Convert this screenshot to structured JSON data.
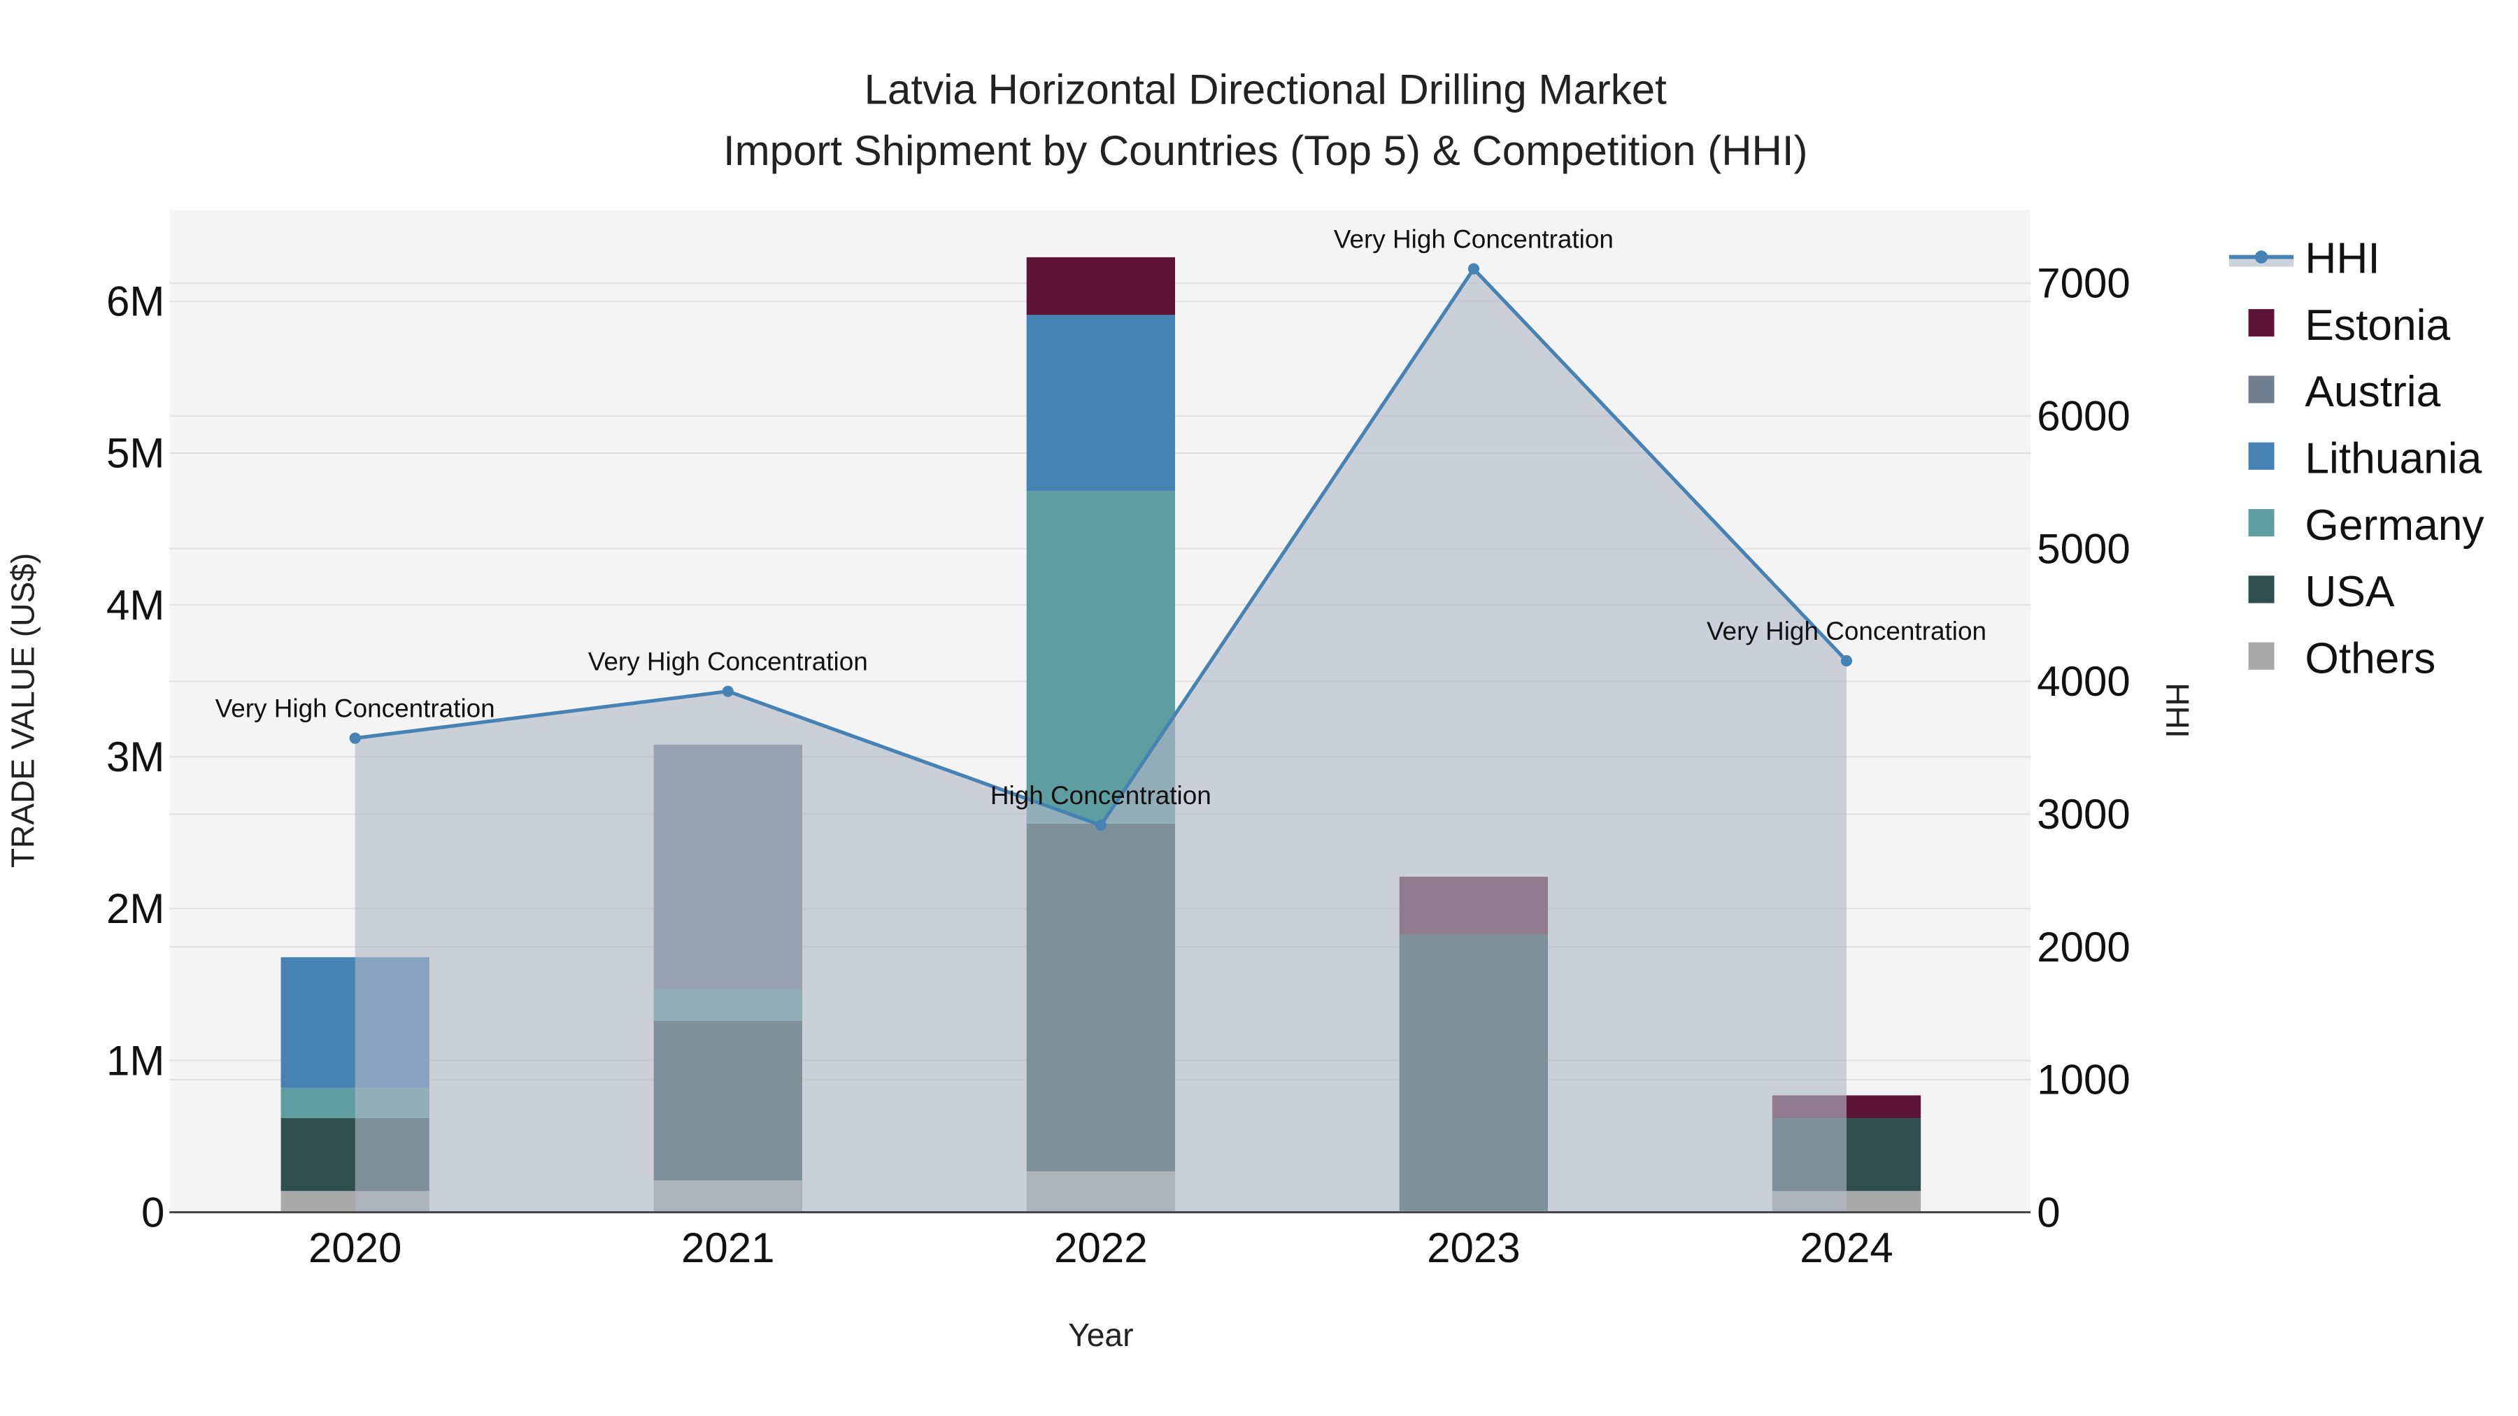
{
  "chart_data": {
    "type": "bar",
    "stacked": true,
    "title_line1": "Latvia Horizontal Directional Drilling Market",
    "title_line2": "Import Shipment by Countries (Top 5) & Competition (HHI)",
    "xlabel": "Year",
    "ylabel": "TRADE VALUE (US$)",
    "y2label": "HHI",
    "categories": [
      "2020",
      "2021",
      "2022",
      "2023",
      "2024"
    ],
    "ylim": [
      0,
      6.6
    ],
    "y_unit": "M",
    "y_ticks": [
      0,
      1,
      2,
      3,
      4,
      5,
      6
    ],
    "y_tick_labels": [
      "0",
      "1M",
      "2M",
      "3M",
      "4M",
      "5M",
      "6M"
    ],
    "y2lim": [
      0,
      7550
    ],
    "y2_ticks": [
      0,
      1000,
      2000,
      3000,
      4000,
      5000,
      6000,
      7000
    ],
    "y2_tick_labels": [
      "0",
      "1000",
      "2000",
      "3000",
      "4000",
      "5000",
      "6000",
      "7000"
    ],
    "series": [
      {
        "name": "Others",
        "color": "#a9a9a9",
        "values": [
          0.14,
          0.21,
          0.27,
          0.01,
          0.14
        ]
      },
      {
        "name": "USA",
        "color": "#2f4f4f",
        "values": [
          0.48,
          1.05,
          2.29,
          1.82,
          0.48
        ]
      },
      {
        "name": "Germany",
        "color": "#5f9ea0",
        "values": [
          0.2,
          0.21,
          2.19,
          0,
          0
        ]
      },
      {
        "name": "Lithuania",
        "color": "#4682b4",
        "values": [
          0.86,
          0,
          1.16,
          0,
          0
        ]
      },
      {
        "name": "Austria",
        "color": "#708090",
        "values": [
          0,
          1.61,
          0,
          0,
          0
        ]
      },
      {
        "name": "Estonia",
        "color": "#5e1535",
        "values": [
          0,
          0,
          0.38,
          0.38,
          0.15
        ]
      }
    ],
    "hhi": {
      "name": "HHI",
      "color": "#4682b4",
      "values": [
        3572,
        3925,
        2916,
        7108,
        4155
      ],
      "annotations": [
        "Very High Concentration",
        "Very High Concentration",
        "High Concentration",
        "Very High Concentration",
        "Very High Concentration"
      ]
    },
    "legend": {
      "position": "right",
      "items": [
        "HHI",
        "Estonia",
        "Austria",
        "Lithuania",
        "Germany",
        "USA",
        "Others"
      ]
    }
  }
}
